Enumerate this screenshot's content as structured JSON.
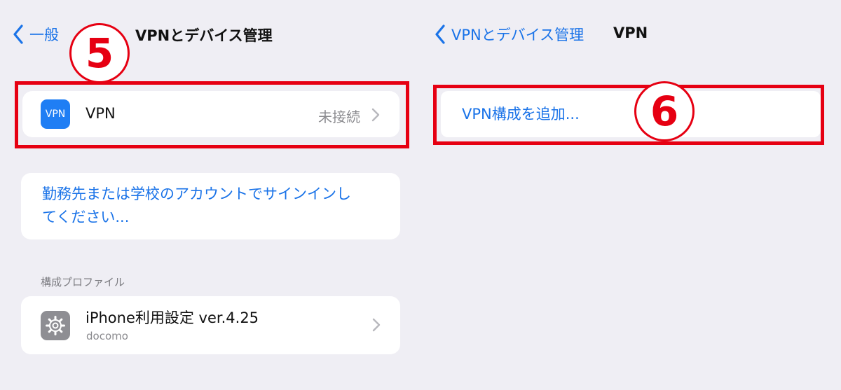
{
  "left": {
    "back_label": "一般",
    "title": "VPNとデバイス管理",
    "vpn_row": {
      "icon_text": "VPN",
      "label": "VPN",
      "status": "未接続"
    },
    "signin_link": {
      "line1": "勤務先または学校のアカウントでサインインし",
      "line2": "てください..."
    },
    "profiles_header": "構成プロファイル",
    "profile": {
      "name": "iPhone利用設定 ver.4.25",
      "issuer": "docomo",
      "icon": "gear-icon"
    },
    "step_number": "5"
  },
  "right": {
    "back_label": "VPNとデバイス管理",
    "title": "VPN",
    "add_vpn_label": "VPN構成を追加...",
    "step_number": "6"
  },
  "colors": {
    "accent": "#1a73e8",
    "highlight_red": "#e60012",
    "background": "#efeef4",
    "vpn_icon": "#1f7ef4"
  }
}
